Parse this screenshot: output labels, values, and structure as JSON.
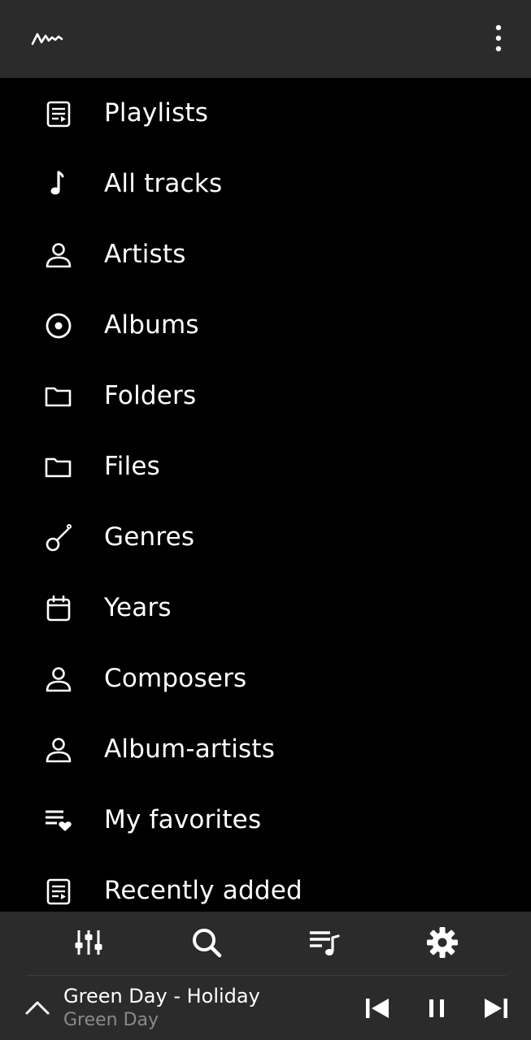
{
  "colors": {
    "background": "#000000",
    "bars": "#2b2b2b",
    "text": "#ffffff",
    "secondary_text": "#8a8a8a"
  },
  "header": {
    "logo_icon": "waveform-logo-icon",
    "menu_icon": "more-vert-icon"
  },
  "library": {
    "items": [
      {
        "label": "Playlists",
        "icon": "playlist-icon"
      },
      {
        "label": "All tracks",
        "icon": "music-note-icon"
      },
      {
        "label": "Artists",
        "icon": "person-icon"
      },
      {
        "label": "Albums",
        "icon": "disc-icon"
      },
      {
        "label": "Folders",
        "icon": "folder-icon"
      },
      {
        "label": "Files",
        "icon": "folder-icon"
      },
      {
        "label": "Genres",
        "icon": "guitar-icon"
      },
      {
        "label": "Years",
        "icon": "calendar-icon"
      },
      {
        "label": "Composers",
        "icon": "person-icon"
      },
      {
        "label": "Album-artists",
        "icon": "person-icon"
      },
      {
        "label": "My favorites",
        "icon": "favorite-list-icon"
      },
      {
        "label": "Recently added",
        "icon": "playlist-icon"
      }
    ]
  },
  "toolbar": {
    "items": [
      "equalizer-icon",
      "search-icon",
      "queue-music-icon",
      "settings-icon"
    ]
  },
  "now_playing": {
    "title": "Green Day - Holiday",
    "artist": "Green Day",
    "controls": [
      "previous-icon",
      "pause-icon",
      "next-icon"
    ]
  }
}
